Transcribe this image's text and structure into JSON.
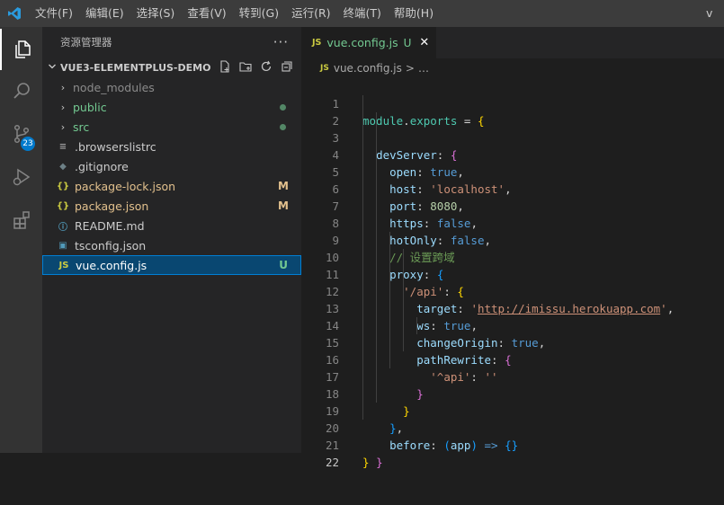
{
  "menu": [
    "文件(F)",
    "编辑(E)",
    "选择(S)",
    "查看(V)",
    "转到(G)",
    "运行(R)",
    "终端(T)",
    "帮助(H)"
  ],
  "window_title_partial": "v",
  "activity": {
    "badge": "23"
  },
  "explorer": {
    "title": "资源管理器",
    "more": "···",
    "folder": "VUE3-ELEMENTPLUS-DEMO",
    "items": [
      {
        "label": "node_modules",
        "status": ""
      },
      {
        "label": "public",
        "status": ""
      },
      {
        "label": "src",
        "status": ""
      },
      {
        "label": ".browserslistrc",
        "status": ""
      },
      {
        "label": ".gitignore",
        "status": ""
      },
      {
        "label": "package-lock.json",
        "status": "M"
      },
      {
        "label": "package.json",
        "status": "M"
      },
      {
        "label": "README.md",
        "status": ""
      },
      {
        "label": "tsconfig.json",
        "status": ""
      },
      {
        "label": "vue.config.js",
        "status": "U"
      }
    ]
  },
  "editor": {
    "tab": {
      "icon": "JS",
      "name": "vue.config.js",
      "status": "U",
      "close": "✕"
    },
    "breadcrumb": {
      "icon": "JS",
      "file": "vue.config.js",
      "sep": ">",
      "rest": "…"
    },
    "line_numbers": [
      "1",
      "2",
      "3",
      "4",
      "5",
      "6",
      "7",
      "8",
      "9",
      "10",
      "11",
      "12",
      "13",
      "14",
      "15",
      "16",
      "17",
      "18",
      "19",
      "20",
      "21",
      "22"
    ],
    "code": {
      "l1_module": "module",
      "l1_exports": "exports",
      "l2_devServer": "devServer",
      "l3_key": "open",
      "l3_val": "true",
      "l4_key": "host",
      "l4_val": "'localhost'",
      "l5_key": "port",
      "l5_val": "8080",
      "l6_key": "https",
      "l6_val": "false",
      "l7_key": "hotOnly",
      "l7_val": "false",
      "l8_comment": "// 设置跨域",
      "l9_key": "proxy",
      "l10_key": "'/api'",
      "l11_key": "target",
      "l11_url": "http://imissu.herokuapp.com",
      "l12_key": "ws",
      "l12_val": "true",
      "l13_key": "changeOrigin",
      "l13_val": "true",
      "l14_key": "pathRewrite",
      "l15_key": "'^api'",
      "l15_val": "''",
      "l19_key": "before",
      "l19_param": "app",
      "l19_arrow": "=>"
    }
  }
}
